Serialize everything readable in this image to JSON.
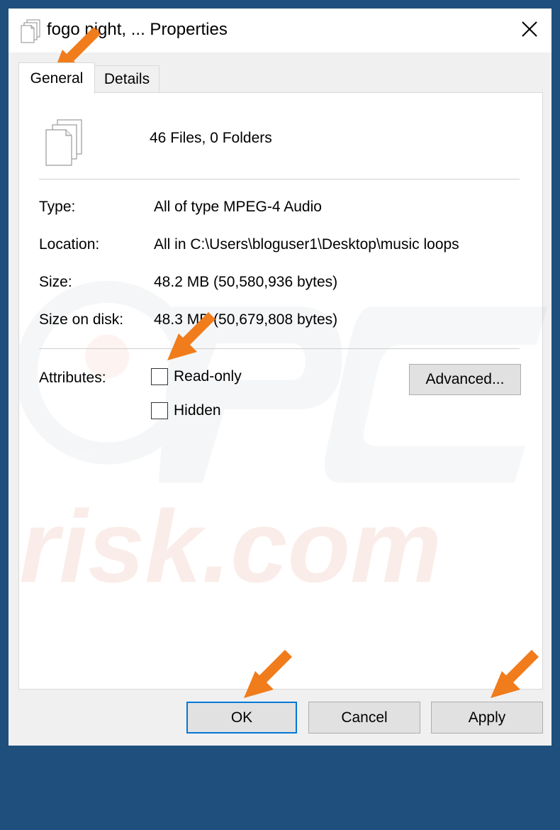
{
  "window": {
    "title": "fogo night, ... Properties",
    "close_label": "Close"
  },
  "tabs": [
    {
      "label": "General",
      "selected": true
    },
    {
      "label": "Details",
      "selected": false
    }
  ],
  "general": {
    "summary": "46 Files, 0 Folders",
    "properties": [
      {
        "label": "Type:",
        "value": "All of type MPEG-4 Audio"
      },
      {
        "label": "Location:",
        "value": "All in C:\\Users\\bloguser1\\Desktop\\music loops"
      },
      {
        "label": "Size:",
        "value": "48.2 MB (50,580,936 bytes)"
      },
      {
        "label": "Size on disk:",
        "value": "48.3 MB (50,679,808 bytes)"
      }
    ],
    "attributes": {
      "label": "Attributes:",
      "read_only": {
        "label": "Read-only",
        "checked": false
      },
      "hidden": {
        "label": "Hidden",
        "checked": false
      },
      "advanced_label": "Advanced..."
    }
  },
  "footer": {
    "ok_label": "OK",
    "cancel_label": "Cancel",
    "apply_label": "Apply"
  },
  "watermark": {
    "text": "risk.com"
  },
  "colors": {
    "frame": "#1f4f7d",
    "accent": "#0078d7",
    "arrow": "#f07c1c"
  },
  "icons": {
    "title": "files-stack-icon",
    "close": "close-icon",
    "summary": "files-stack-icon",
    "annotation": "arrow-pointer-icon"
  }
}
